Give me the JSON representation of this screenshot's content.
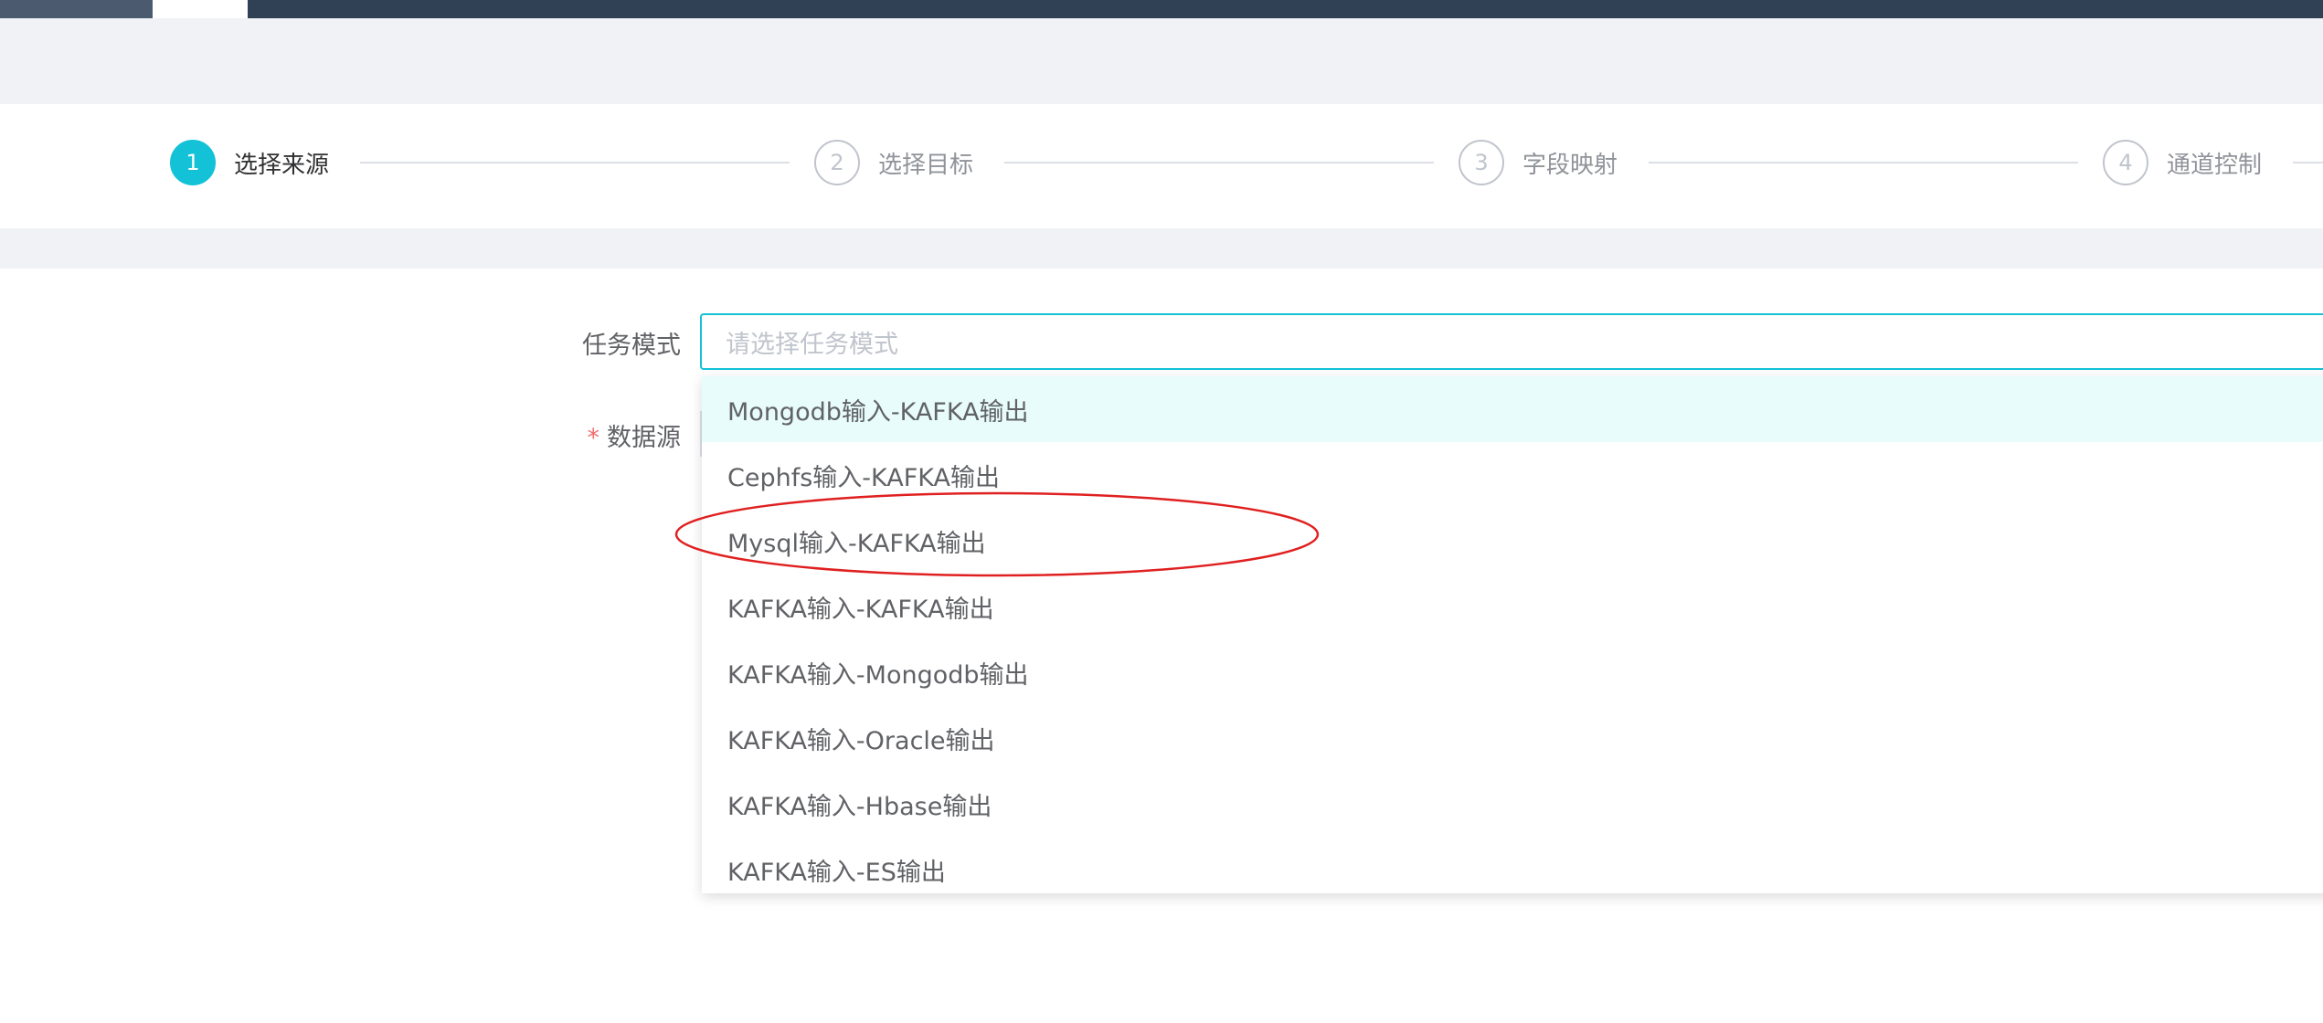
{
  "steps": [
    {
      "number": "1",
      "label": "选择来源",
      "active": true
    },
    {
      "number": "2",
      "label": "选择目标",
      "active": false
    },
    {
      "number": "3",
      "label": "字段映射",
      "active": false
    },
    {
      "number": "4",
      "label": "通道控制",
      "active": false
    }
  ],
  "form": {
    "task_mode_label": "任务模式",
    "task_mode_placeholder": "请选择任务模式",
    "datasource_label": "数据源",
    "required_mark": "*"
  },
  "dropdown": {
    "options": [
      "Mongodb输入-KAFKA输出",
      "Cephfs输入-KAFKA输出",
      "Mysql输入-KAFKA输出",
      "KAFKA输入-KAFKA输出",
      "KAFKA输入-Mongodb输出",
      "KAFKA输入-Oracle输出",
      "KAFKA输入-Hbase输出",
      "KAFKA输入-ES输出"
    ],
    "hovered_index": 0,
    "highlighted_index": 2
  },
  "colors": {
    "accent": "#13c2d6",
    "nav": "#304156",
    "annotation": "#e02020"
  }
}
